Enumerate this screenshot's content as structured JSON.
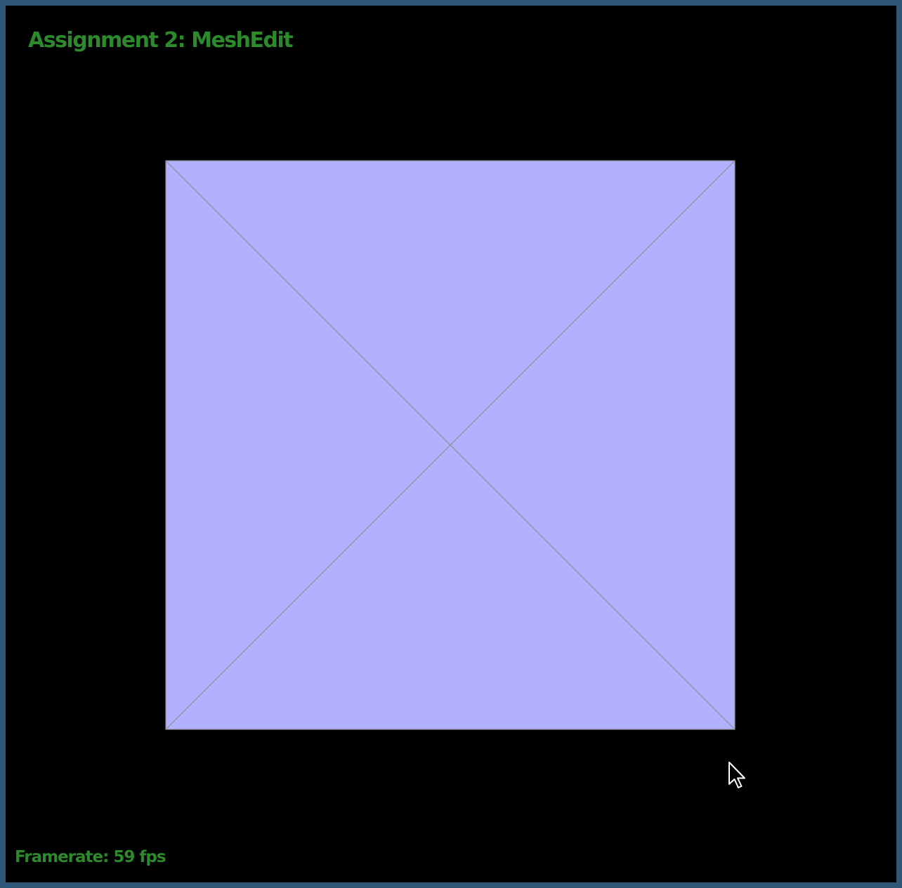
{
  "window": {
    "title": "Assignment 2: MeshEdit"
  },
  "status": {
    "framerate_label": "Framerate: 59 fps"
  },
  "colors": {
    "frame_border": "#2f5878",
    "background": "#000000",
    "hud_text": "#2c8a2c",
    "mesh_face": "#b1b1fe",
    "mesh_edge": "#8f8f9a"
  },
  "icons": {
    "cursor": "mouse-pointer-icon"
  }
}
